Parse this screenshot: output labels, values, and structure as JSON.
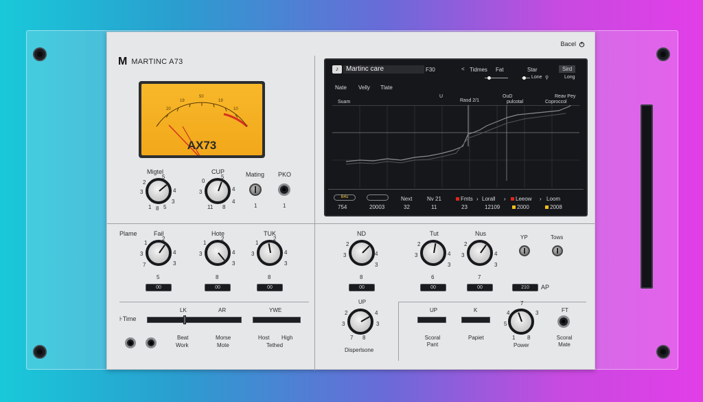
{
  "header": {
    "logo_glyph": "M",
    "title": "MARTINC A73",
    "preset_label": "Bacel",
    "preset_icon": "power-icon"
  },
  "vu_meter": {
    "title": "AX73",
    "scale": [
      "20",
      "19",
      "50",
      "19",
      "10"
    ]
  },
  "top_controls": {
    "knob1": {
      "label": "Migtel",
      "marks": [
        "2",
        "5",
        "4",
        "3",
        "3",
        "1",
        "8",
        "5"
      ]
    },
    "knob2": {
      "label": "CUP",
      "marks": [
        "0",
        "5",
        "4",
        "3",
        "4",
        "11",
        "8"
      ]
    },
    "toggle_label": "Mating",
    "toggle_value": "1",
    "jack_label": "PKO",
    "jack_value": "1"
  },
  "display": {
    "track_icon": "note-icon",
    "track_name": "Martinc care",
    "track_num": "F30",
    "nav_prev": "<",
    "menu1": "Tidmes",
    "menu2": "Fat",
    "menu3": "Star",
    "menu4": "Sird",
    "sub1": "Lone",
    "sub2": "Long",
    "tabs": [
      "Nate",
      "Velly",
      "Tlate"
    ],
    "row_labels": [
      "Suam",
      "U",
      "Rasd 2/1",
      "OuD",
      "pulcotal",
      "Reav Pey",
      "Coproccol"
    ],
    "footer": {
      "pill1": "B4u",
      "pill2": "",
      "v1": "754",
      "v2": "20003",
      "next": "Next",
      "next_val": "32",
      "nv": "Nv 21",
      "nv_val": "11",
      "fmts": "Fmts",
      "fmts_val": "23",
      "lorall": "Lorall",
      "lorall_val": "12109",
      "leeow": "Leeow",
      "leeow_val": "2000",
      "loom": "Loom",
      "loom_val": "2008",
      "arrow": "›"
    }
  },
  "mid_left": {
    "section_label": "Plame",
    "knobs": [
      {
        "label": "Fail",
        "readout": "00",
        "bottom": "5"
      },
      {
        "label": "Hote",
        "readout": "00",
        "bottom": "8"
      },
      {
        "label": "TUK",
        "readout": "00",
        "bottom": "8"
      }
    ],
    "knob_marks": [
      "1",
      "2",
      "4",
      "3",
      "3",
      "7",
      "2"
    ]
  },
  "mid_right": {
    "knobs": [
      {
        "label": "ND",
        "readout": "00",
        "bottom": "8"
      },
      {
        "label": "Tut",
        "readout": "00",
        "bottom": "6"
      },
      {
        "label": "Nus",
        "readout": "00",
        "bottom": "7"
      }
    ],
    "yp_label": "YP",
    "tows_label": "Tows",
    "ap_readout": "210",
    "ap_label": "AP"
  },
  "bottom_left": {
    "time_label": "Time",
    "slider_labels": [
      "LK",
      "AR",
      "YWE"
    ],
    "caption1": [
      "Beat",
      "Work"
    ],
    "caption2": [
      "Morse",
      "Mote"
    ],
    "caption3": [
      "Host",
      "High",
      "Tethed"
    ]
  },
  "bottom_mid": {
    "label": "UP",
    "caption": "Disperlsone"
  },
  "bottom_right": {
    "labels": [
      "UP",
      "K",
      "FT"
    ],
    "captions": [
      "Scoral Pant",
      "Papiet",
      "Power",
      "Scoral Mate"
    ],
    "power_marks": [
      "7",
      "4",
      "3",
      "5",
      "1",
      "8"
    ]
  },
  "colors": {
    "accent_yellow": "#f2a81a",
    "panel": "#e6e7e9",
    "dark": "#16171a",
    "red": "#e0261f"
  }
}
